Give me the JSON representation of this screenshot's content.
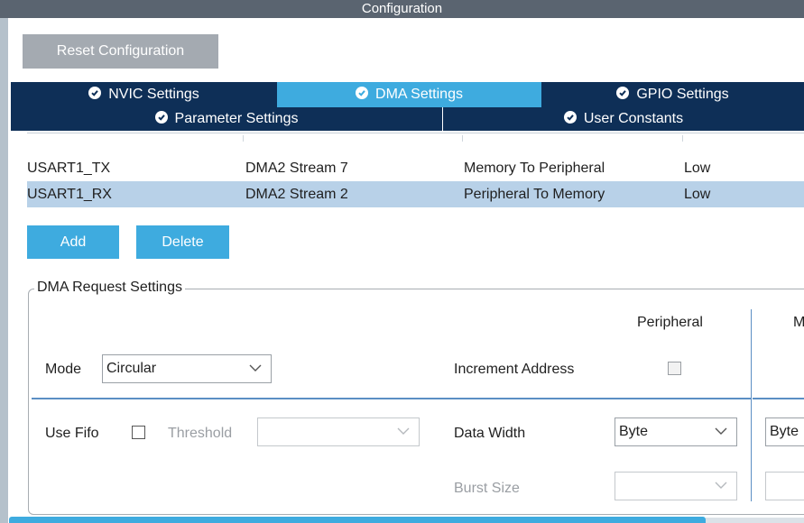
{
  "window": {
    "title": "Configuration"
  },
  "toolbar": {
    "reset_label": "Reset Configuration"
  },
  "tabs": {
    "row1": [
      {
        "label": "NVIC Settings",
        "active": false
      },
      {
        "label": "DMA Settings",
        "active": true
      },
      {
        "label": "GPIO Settings",
        "active": false
      }
    ],
    "row2": [
      {
        "label": "Parameter Settings",
        "active": false
      },
      {
        "label": "User Constants",
        "active": false
      }
    ]
  },
  "dma_table": {
    "rows": [
      {
        "request": "USART1_TX",
        "stream": "DMA2 Stream 7",
        "direction": "Memory To Peripheral",
        "priority": "Low",
        "selected": false
      },
      {
        "request": "USART1_RX",
        "stream": "DMA2 Stream 2",
        "direction": "Peripheral To Memory",
        "priority": "Low",
        "selected": true
      }
    ]
  },
  "actions": {
    "add_label": "Add",
    "delete_label": "Delete"
  },
  "request_settings": {
    "legend": "DMA Request Settings",
    "peripheral_header": "Peripheral",
    "memory_header_partial": "M",
    "mode_label": "Mode",
    "mode_value": "Circular",
    "increment_address_label": "Increment Address",
    "peripheral_increment_checked": false,
    "use_fifo_label": "Use Fifo",
    "use_fifo_checked": false,
    "threshold_label": "Threshold",
    "threshold_value": "",
    "data_width_label": "Data Width",
    "peripheral_data_width": "Byte",
    "memory_data_width_partial": "Byte",
    "burst_size_label": "Burst Size",
    "peripheral_burst_size": "",
    "memory_burst_size": ""
  },
  "colors": {
    "accent": "#3eabdf",
    "tab_dark": "#0e2f57",
    "selected_row": "#b8d1e8",
    "titlebar": "#5a6470"
  }
}
